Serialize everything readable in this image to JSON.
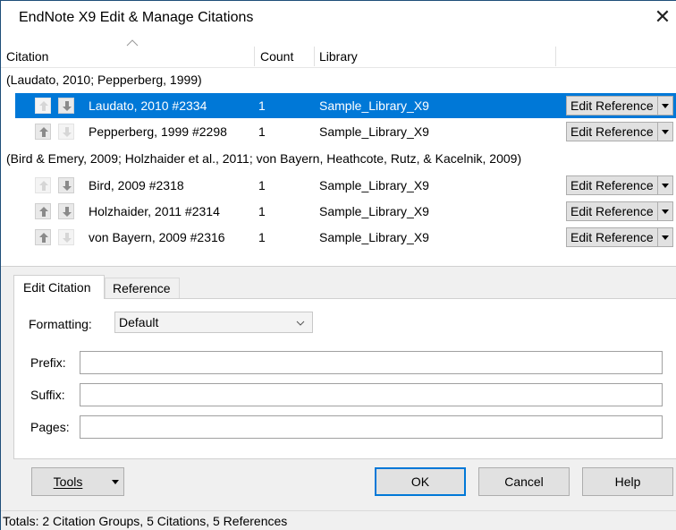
{
  "window": {
    "title": "EndNote X9 Edit & Manage Citations"
  },
  "columns": {
    "citation": "Citation",
    "count": "Count",
    "library": "Library"
  },
  "groups": [
    {
      "label": "(Laudato, 2010; Pepperberg, 1999)",
      "citations": [
        {
          "name": "Laudato, 2010 #2334",
          "count": "1",
          "library": "Sample_Library_X9",
          "action": "Edit Reference"
        },
        {
          "name": "Pepperberg, 1999 #2298",
          "count": "1",
          "library": "Sample_Library_X9",
          "action": "Edit Reference"
        }
      ]
    },
    {
      "label": "(Bird & Emery, 2009; Holzhaider et al., 2011; von Bayern, Heathcote, Rutz, & Kacelnik, 2009)",
      "citations": [
        {
          "name": "Bird, 2009 #2318",
          "count": "1",
          "library": "Sample_Library_X9",
          "action": "Edit Reference"
        },
        {
          "name": "Holzhaider, 2011 #2314",
          "count": "1",
          "library": "Sample_Library_X9",
          "action": "Edit Reference"
        },
        {
          "name": "von Bayern, 2009 #2316",
          "count": "1",
          "library": "Sample_Library_X9",
          "action": "Edit Reference"
        }
      ]
    }
  ],
  "tabs": {
    "edit_citation": "Edit Citation",
    "reference": "Reference"
  },
  "form": {
    "formatting_label": "Formatting:",
    "formatting_value": "Default",
    "prefix_label": "Prefix:",
    "suffix_label": "Suffix:",
    "pages_label": "Pages:",
    "prefix_value": "",
    "suffix_value": "",
    "pages_value": ""
  },
  "buttons": {
    "tools": "Tools",
    "ok": "OK",
    "cancel": "Cancel",
    "help": "Help"
  },
  "status": {
    "totals": "Totals: 2 Citation Groups, 5 Citations, 5 References"
  },
  "colors": {
    "selection": "#0078d7",
    "accent_border": "#0078d7"
  },
  "icons": {
    "close": "close-icon",
    "up": "arrow-up-icon",
    "down": "arrow-down-icon",
    "dropdown": "chevron-down-icon"
  }
}
